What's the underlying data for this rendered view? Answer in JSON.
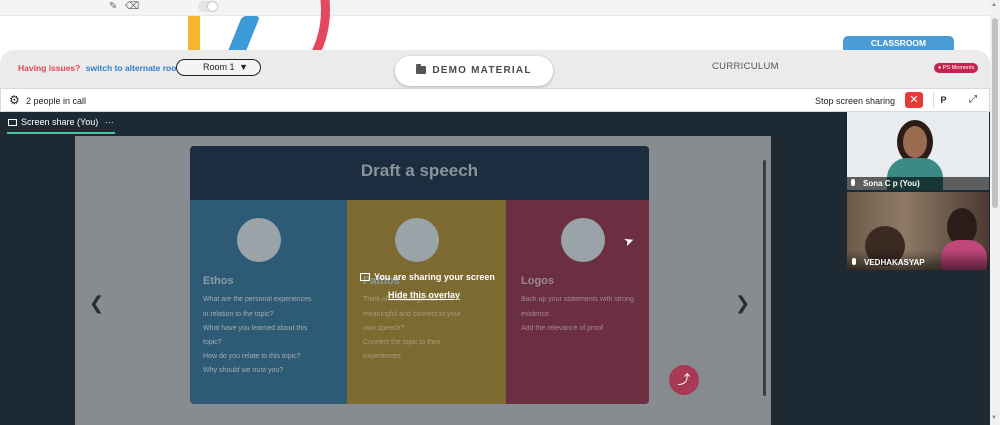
{
  "toolbar": {
    "pencil_icon": "pencil-icon",
    "eraser_icon": "eraser-icon"
  },
  "class_bar": {
    "issues_text": "Having issues?",
    "alternate_room_link": "switch to alternate room",
    "room_select_value": "Room 1",
    "demo_material_label": "DEMO MATERIAL",
    "curriculum_label": "CURRICULUM",
    "classroom_tab_label": "CLASSROOM",
    "ps_moments_label": "PS Moments"
  },
  "call_bar": {
    "people_count_text": "2 people in call",
    "stop_sharing_label": "Stop screen sharing",
    "stop_x_glyph": "✕",
    "p_button_label": "P",
    "expand_glyph": "⤢"
  },
  "share": {
    "tab_label": "Screen share (You)",
    "tab_more": "···",
    "overlay_title": "You are sharing your screen",
    "overlay_link": "Hide this overlay"
  },
  "slide": {
    "title": "Draft a speech",
    "columns": [
      {
        "heading": "Ethos",
        "lines": [
          "What are the personal experiences",
          "in relation to the topic?",
          "What have you learned about this",
          "topic?",
          "How do you relate to this topic?",
          "Why should we trust you?"
        ]
      },
      {
        "heading": "Pathos",
        "lines": [
          "Think of a message that is",
          "meaningful and connect to your",
          "own speech?",
          "Connect the topic to their",
          "experiences"
        ]
      },
      {
        "heading": "Logos",
        "lines": [
          "Back up your statements with strong",
          "evidence.",
          "Add the relevance of proof"
        ]
      }
    ],
    "prev_arrow": "❮",
    "next_arrow": "❯",
    "share_fab_glyph": "⤴"
  },
  "participants": [
    {
      "name": "Sona C p (You)"
    },
    {
      "name": "VEDHAKASYAP"
    }
  ],
  "colors": {
    "accent_red": "#e53935",
    "classroom_blue": "#4a9bd6",
    "issues_red": "#e0465a",
    "link_blue": "#2e7fcb",
    "tab_underline": "#4fc3a1"
  }
}
